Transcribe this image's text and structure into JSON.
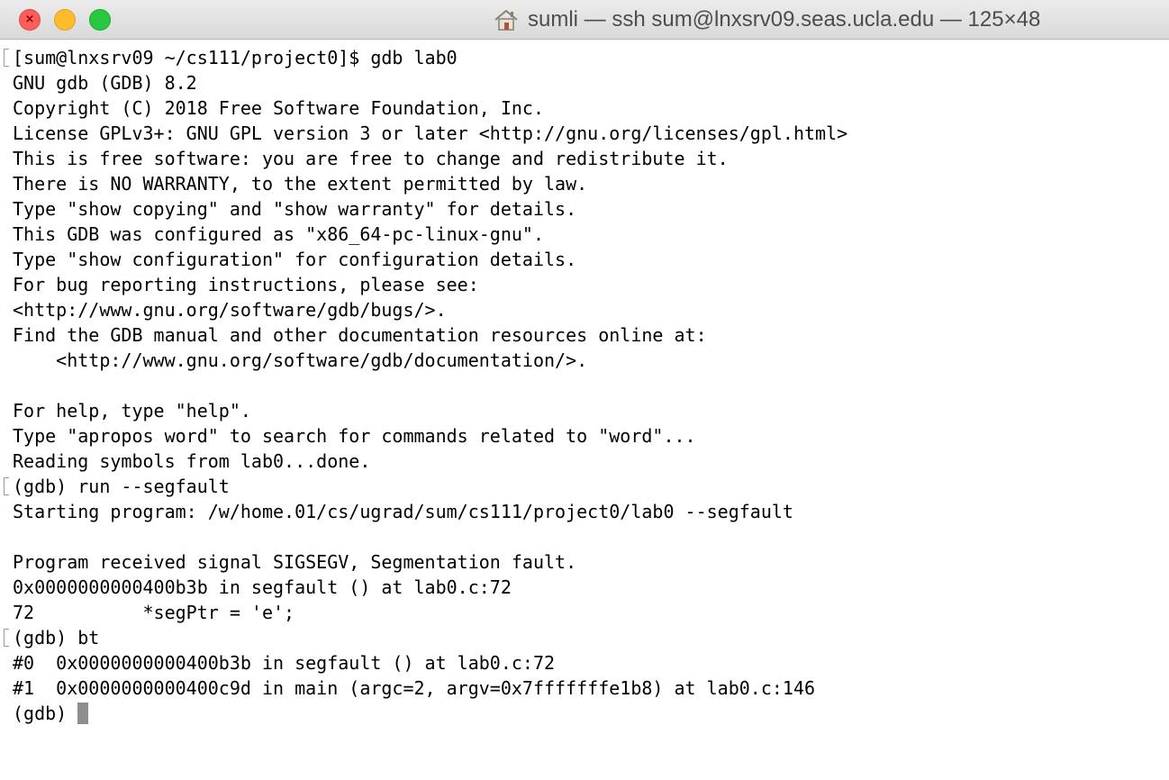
{
  "window": {
    "title": "sumli — ssh sum@lnxsrv09.seas.ucla.edu — 125×48",
    "close_glyph": "×",
    "colors": {
      "close": "#fc5f57",
      "minimize": "#fdbc2e",
      "zoom": "#28c840"
    }
  },
  "terminal": {
    "lines": [
      "[sum@lnxsrv09 ~/cs111/project0]$ gdb lab0",
      "GNU gdb (GDB) 8.2",
      "Copyright (C) 2018 Free Software Foundation, Inc.",
      "License GPLv3+: GNU GPL version 3 or later <http://gnu.org/licenses/gpl.html>",
      "This is free software: you are free to change and redistribute it.",
      "There is NO WARRANTY, to the extent permitted by law.",
      "Type \"show copying\" and \"show warranty\" for details.",
      "This GDB was configured as \"x86_64-pc-linux-gnu\".",
      "Type \"show configuration\" for configuration details.",
      "For bug reporting instructions, please see:",
      "<http://www.gnu.org/software/gdb/bugs/>.",
      "Find the GDB manual and other documentation resources online at:",
      "    <http://www.gnu.org/software/gdb/documentation/>.",
      "",
      "For help, type \"help\".",
      "Type \"apropos word\" to search for commands related to \"word\"...",
      "Reading symbols from lab0...done.",
      "(gdb) run --segfault",
      "Starting program: /w/home.01/cs/ugrad/sum/cs111/project0/lab0 --segfault",
      "",
      "Program received signal SIGSEGV, Segmentation fault.",
      "0x0000000000400b3b in segfault () at lab0.c:72",
      "72\t    *segPtr = 'e';",
      "(gdb) bt",
      "#0  0x0000000000400b3b in segfault () at lab0.c:72",
      "#1  0x0000000000400c9d in main (argc=2, argv=0x7fffffffe1b8) at lab0.c:146"
    ],
    "current_prompt": "(gdb) "
  }
}
